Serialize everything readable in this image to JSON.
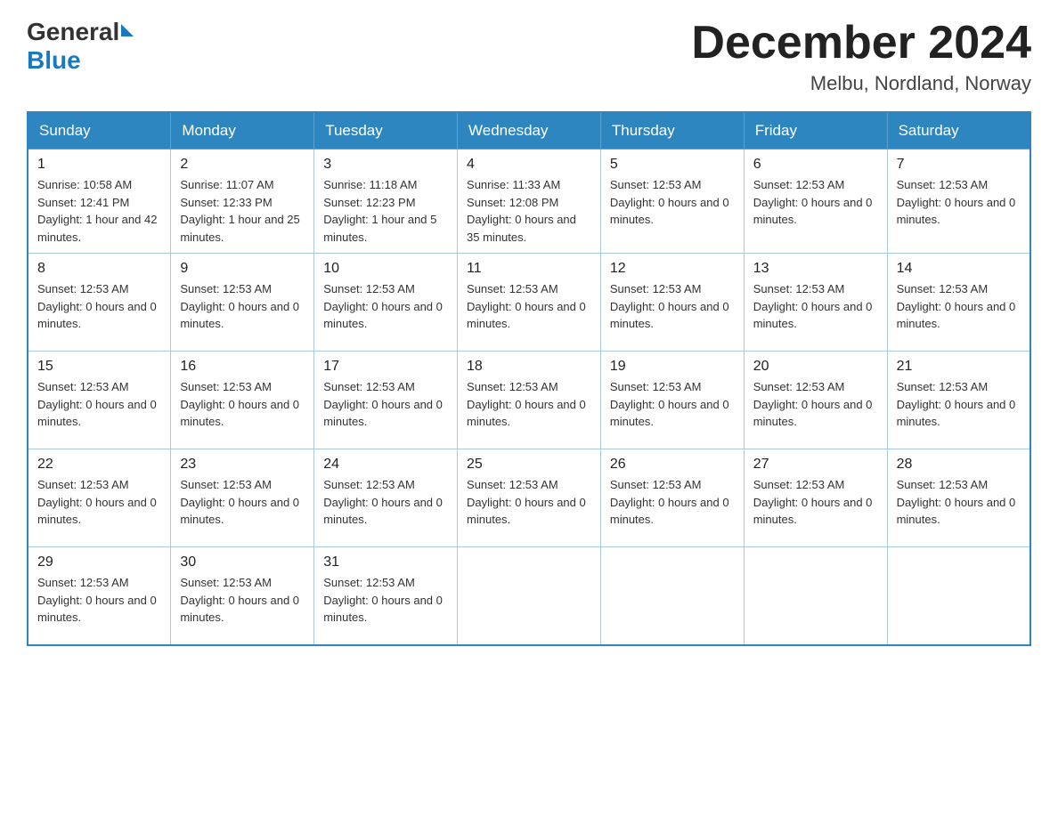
{
  "header": {
    "logo_general": "General",
    "logo_blue": "Blue",
    "month_title": "December 2024",
    "location": "Melbu, Nordland, Norway"
  },
  "days_of_week": [
    "Sunday",
    "Monday",
    "Tuesday",
    "Wednesday",
    "Thursday",
    "Friday",
    "Saturday"
  ],
  "weeks": [
    {
      "days": [
        {
          "number": "1",
          "info": "Sunrise: 10:58 AM\nSunset: 12:41 PM\nDaylight: 1 hour and\n42 minutes."
        },
        {
          "number": "2",
          "info": "Sunrise: 11:07 AM\nSunset: 12:33 PM\nDaylight: 1 hour and\n25 minutes."
        },
        {
          "number": "3",
          "info": "Sunrise: 11:18 AM\nSunset: 12:23 PM\nDaylight: 1 hour and\n5 minutes."
        },
        {
          "number": "4",
          "info": "Sunrise: 11:33 AM\nSunset: 12:08 PM\nDaylight: 0 hours\nand 35 minutes."
        },
        {
          "number": "5",
          "info": "Sunset: 12:53 AM\nDaylight: 0 hours\nand 0 minutes."
        },
        {
          "number": "6",
          "info": "Sunset: 12:53 AM\nDaylight: 0 hours\nand 0 minutes."
        },
        {
          "number": "7",
          "info": "Sunset: 12:53 AM\nDaylight: 0 hours\nand 0 minutes."
        }
      ]
    },
    {
      "days": [
        {
          "number": "8",
          "info": "Sunset: 12:53 AM\nDaylight: 0 hours\nand 0 minutes."
        },
        {
          "number": "9",
          "info": "Sunset: 12:53 AM\nDaylight: 0 hours\nand 0 minutes."
        },
        {
          "number": "10",
          "info": "Sunset: 12:53 AM\nDaylight: 0 hours\nand 0 minutes."
        },
        {
          "number": "11",
          "info": "Sunset: 12:53 AM\nDaylight: 0 hours\nand 0 minutes."
        },
        {
          "number": "12",
          "info": "Sunset: 12:53 AM\nDaylight: 0 hours\nand 0 minutes."
        },
        {
          "number": "13",
          "info": "Sunset: 12:53 AM\nDaylight: 0 hours\nand 0 minutes."
        },
        {
          "number": "14",
          "info": "Sunset: 12:53 AM\nDaylight: 0 hours\nand 0 minutes."
        }
      ]
    },
    {
      "days": [
        {
          "number": "15",
          "info": "Sunset: 12:53 AM\nDaylight: 0 hours\nand 0 minutes."
        },
        {
          "number": "16",
          "info": "Sunset: 12:53 AM\nDaylight: 0 hours\nand 0 minutes."
        },
        {
          "number": "17",
          "info": "Sunset: 12:53 AM\nDaylight: 0 hours\nand 0 minutes."
        },
        {
          "number": "18",
          "info": "Sunset: 12:53 AM\nDaylight: 0 hours\nand 0 minutes."
        },
        {
          "number": "19",
          "info": "Sunset: 12:53 AM\nDaylight: 0 hours\nand 0 minutes."
        },
        {
          "number": "20",
          "info": "Sunset: 12:53 AM\nDaylight: 0 hours\nand 0 minutes."
        },
        {
          "number": "21",
          "info": "Sunset: 12:53 AM\nDaylight: 0 hours\nand 0 minutes."
        }
      ]
    },
    {
      "days": [
        {
          "number": "22",
          "info": "Sunset: 12:53 AM\nDaylight: 0 hours\nand 0 minutes."
        },
        {
          "number": "23",
          "info": "Sunset: 12:53 AM\nDaylight: 0 hours\nand 0 minutes."
        },
        {
          "number": "24",
          "info": "Sunset: 12:53 AM\nDaylight: 0 hours\nand 0 minutes."
        },
        {
          "number": "25",
          "info": "Sunset: 12:53 AM\nDaylight: 0 hours\nand 0 minutes."
        },
        {
          "number": "26",
          "info": "Sunset: 12:53 AM\nDaylight: 0 hours\nand 0 minutes."
        },
        {
          "number": "27",
          "info": "Sunset: 12:53 AM\nDaylight: 0 hours\nand 0 minutes."
        },
        {
          "number": "28",
          "info": "Sunset: 12:53 AM\nDaylight: 0 hours\nand 0 minutes."
        }
      ]
    },
    {
      "days": [
        {
          "number": "29",
          "info": "Sunset: 12:53 AM\nDaylight: 0 hours\nand 0 minutes."
        },
        {
          "number": "30",
          "info": "Sunset: 12:53 AM\nDaylight: 0 hours\nand 0 minutes."
        },
        {
          "number": "31",
          "info": "Sunset: 12:53 AM\nDaylight: 0 hours\nand 0 minutes."
        },
        {
          "number": "",
          "info": ""
        },
        {
          "number": "",
          "info": ""
        },
        {
          "number": "",
          "info": ""
        },
        {
          "number": "",
          "info": ""
        }
      ]
    }
  ]
}
